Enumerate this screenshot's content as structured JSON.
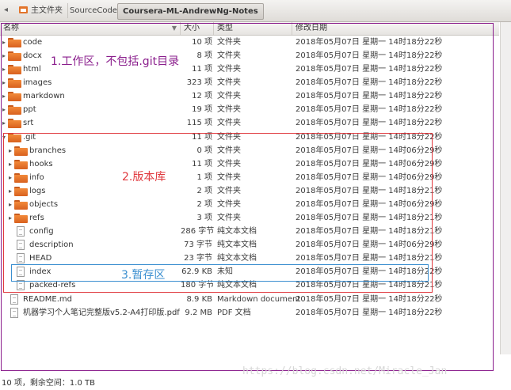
{
  "pathbar": {
    "crumbs": [
      {
        "label": "主文件夹",
        "active": false
      },
      {
        "label": "SourceCode",
        "active": false
      },
      {
        "label": "Coursera-ML-AndrewNg-Notes",
        "active": true
      }
    ]
  },
  "columns": {
    "name": "名称",
    "size": "大小",
    "type": "类型",
    "date": "修改日期"
  },
  "rows": [
    {
      "name": "code",
      "size": "10 项",
      "type": "文件夹",
      "date": "2018年05月07日 星期一 14时18分22秒",
      "icon": "folder",
      "level": 0
    },
    {
      "name": "docx",
      "size": "8 项",
      "type": "文件夹",
      "date": "2018年05月07日 星期一 14时18分22秒",
      "icon": "folder",
      "level": 0
    },
    {
      "name": "html",
      "size": "11 项",
      "type": "文件夹",
      "date": "2018年05月07日 星期一 14时18分22秒",
      "icon": "folder",
      "level": 0
    },
    {
      "name": "images",
      "size": "323 项",
      "type": "文件夹",
      "date": "2018年05月07日 星期一 14时18分22秒",
      "icon": "folder",
      "level": 0
    },
    {
      "name": "markdown",
      "size": "12 项",
      "type": "文件夹",
      "date": "2018年05月07日 星期一 14时18分22秒",
      "icon": "folder",
      "level": 0
    },
    {
      "name": "ppt",
      "size": "19 项",
      "type": "文件夹",
      "date": "2018年05月07日 星期一 14时18分22秒",
      "icon": "folder",
      "level": 0
    },
    {
      "name": "srt",
      "size": "115 项",
      "type": "文件夹",
      "date": "2018年05月07日 星期一 14时18分22秒",
      "icon": "folder",
      "level": 0
    },
    {
      "name": ".git",
      "size": "11 项",
      "type": "文件夹",
      "date": "2018年05月07日 星期一 14时18分22秒",
      "icon": "folder",
      "level": 0,
      "expanded": true
    },
    {
      "name": "branches",
      "size": "0 项",
      "type": "文件夹",
      "date": "2018年05月07日 星期一 14时06分29秒",
      "icon": "folder",
      "level": 1
    },
    {
      "name": "hooks",
      "size": "11 项",
      "type": "文件夹",
      "date": "2018年05月07日 星期一 14时06分29秒",
      "icon": "folder",
      "level": 1
    },
    {
      "name": "info",
      "size": "1 项",
      "type": "文件夹",
      "date": "2018年05月07日 星期一 14时06分29秒",
      "icon": "folder",
      "level": 1
    },
    {
      "name": "logs",
      "size": "2 项",
      "type": "文件夹",
      "date": "2018年05月07日 星期一 14时18分21秒",
      "icon": "folder",
      "level": 1
    },
    {
      "name": "objects",
      "size": "2 项",
      "type": "文件夹",
      "date": "2018年05月07日 星期一 14时06分29秒",
      "icon": "folder",
      "level": 1
    },
    {
      "name": "refs",
      "size": "3 项",
      "type": "文件夹",
      "date": "2018年05月07日 星期一 14时18分21秒",
      "icon": "folder",
      "level": 1
    },
    {
      "name": "config",
      "size": "286 字节",
      "type": "纯文本文档",
      "date": "2018年05月07日 星期一 14时18分21秒",
      "icon": "file",
      "level": 1
    },
    {
      "name": "description",
      "size": "73 字节",
      "type": "纯文本文档",
      "date": "2018年05月07日 星期一 14时06分29秒",
      "icon": "file",
      "level": 1
    },
    {
      "name": "HEAD",
      "size": "23 字节",
      "type": "纯文本文档",
      "date": "2018年05月07日 星期一 14时18分21秒",
      "icon": "file",
      "level": 1
    },
    {
      "name": "index",
      "size": "62.9 KB",
      "type": "未知",
      "date": "2018年05月07日 星期一 14时18分22秒",
      "icon": "file",
      "level": 1
    },
    {
      "name": "packed-refs",
      "size": "180 字节",
      "type": "纯文本文档",
      "date": "2018年05月07日 星期一 14时18分21秒",
      "icon": "file",
      "level": 1
    },
    {
      "name": "README.md",
      "size": "8.9 KB",
      "type": "Markdown document",
      "date": "2018年05月07日 星期一 14时18分22秒",
      "icon": "file",
      "level": 0
    },
    {
      "name": "机器学习个人笔记完整版v5.2-A4打印版.pdf",
      "size": "9.2 MB",
      "type": "PDF 文档",
      "date": "2018年05月07日 星期一 14时18分22秒",
      "icon": "file",
      "level": 0
    }
  ],
  "annotations": {
    "workdir": "1.工作区，不包括.git目录",
    "repo": "2.版本库",
    "stage": "3.暂存区"
  },
  "status": "10 项，剩余空间：1.0 TB",
  "watermark": "https://blog.csdn.net/Miracle_Jan",
  "colors": {
    "workdir_box": "#8a1d8c",
    "repo_box": "#e0393e",
    "stage_box": "#3b8fd0",
    "folder": "#e8742a"
  }
}
